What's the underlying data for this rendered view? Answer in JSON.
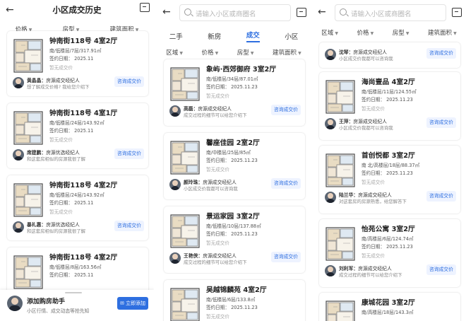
{
  "colors": {
    "accent": "#2e6fe0",
    "accent_bg": "#eef3ff",
    "muted": "#888888"
  },
  "icons": {
    "back": "back-arrow-icon",
    "message": "message-icon",
    "search": "search-icon",
    "chat": "chat-icon"
  },
  "panel1": {
    "title": "小区成交历史",
    "filters": [
      "价格",
      "房型",
      "建筑面积"
    ],
    "cards": [
      {
        "name": "钟南街118号 4室2厅",
        "meta": "南/低楼层/7层/317.91㎡",
        "date": "签约日期： 2025.11",
        "price": "暂无成交价",
        "agent": "黄晶晶：",
        "agent_role": "房源成交经纪人",
        "agent_msg": "想了解成交价格? 我给您介绍下",
        "button": "咨询成交价"
      },
      {
        "name": "钟南街118号 4室1厅",
        "meta": "南/低楼层/24层/143.92㎡",
        "date": "签约日期： 2025.11",
        "price": "暂无成交价",
        "agent": "席建鹏：",
        "agent_role": "房源优选经纪人",
        "agent_msg": "和这套房相似的房源我很了解",
        "button": "咨询成交价"
      },
      {
        "name": "钟南街118号 4室2厅",
        "meta": "南/低楼层/24层/143.92㎡",
        "date": "签约日期： 2025.11",
        "price": "暂无成交价",
        "agent": "暴礼惠：",
        "agent_role": "房源优选经纪人",
        "agent_msg": "和这套房相似的房源我很了解",
        "button": "咨询成交价"
      },
      {
        "name": "钟南街118号 4室2厅",
        "meta": "南/低楼层/8层/163.56㎡",
        "date": "签约日期： 2025.11",
        "price": "",
        "agent": "",
        "agent_role": "",
        "agent_msg": "",
        "button": ""
      }
    ],
    "bottom": {
      "title": "添加购房助手",
      "subtitle": "小区行情、成交动态等抢先知",
      "button": "立即添加"
    }
  },
  "panel2": {
    "search_placeholder": "请输入小区或商圈名",
    "tabs": [
      "二手",
      "新房",
      "成交",
      "小区"
    ],
    "filters": [
      "区域",
      "价格",
      "房型",
      "建筑面积"
    ],
    "cards": [
      {
        "name": "象屿·西郊御府 3室2厅",
        "meta": "南/低楼层/34层/87.01㎡",
        "date": "签约日期： 2025.11.23",
        "price": "暂无成交价",
        "agent": "高磊：",
        "agent_role": "房源成交经纪人",
        "agent_msg": "成交过程的细节可以给您介绍下",
        "button": "咨询成交价"
      },
      {
        "name": "馨座佳园 2室2厅",
        "meta": "南/中楼层/25层/85㎡",
        "date": "签约日期： 2025.11.23",
        "price": "暂无成交价",
        "agent": "颜玲珠：",
        "agent_role": "房源成交经纪人",
        "agent_msg": "小区成交价我都可以咨询我",
        "button": "咨询成交价"
      },
      {
        "name": "景运家园 3室2厅",
        "meta": "南/低楼层/10层/137.88㎡",
        "date": "签约日期： 2025.11.23",
        "price": "暂无成交价",
        "agent": "王艳侠：",
        "agent_role": "房源成交经纪人",
        "agent_msg": "成交过程的细节可以给您介绍下",
        "button": "咨询成交价"
      },
      {
        "name": "吴越锦麟苑 4室2厅",
        "meta": "南/低楼层/6层/133.8㎡",
        "date": "签约日期： 2025.11.23",
        "price": "暂无成交价",
        "agent": "",
        "agent_role": "",
        "agent_msg": "",
        "button": ""
      }
    ]
  },
  "panel3": {
    "search_placeholder": "请输入小区或商圈名",
    "filters": [
      "区域",
      "价格",
      "房型",
      "建筑面积"
    ],
    "first_agent": {
      "agent": "沈琴：",
      "agent_role": "房源成交经纪人",
      "agent_msg": "小区成交价我都可以咨询我",
      "button": "咨询成交价"
    },
    "cards": [
      {
        "name": "海尚壹品 4室2厅",
        "meta": "南/低楼层/11层/124.55㎡",
        "date": "签约日期： 2025.11.23",
        "price": "暂无成交价",
        "agent": "王萍：",
        "agent_role": "房源成交经纪人",
        "agent_msg": "小区成交价我都可以咨询我",
        "button": "咨询成交价"
      },
      {
        "name": "首创悦都 3室2厅",
        "meta": "南 北/高楼层/18层/88.37㎡",
        "date": "签约日期： 2025.11.23",
        "price": "暂无成交价",
        "agent": "陆兰华：",
        "agent_role": "房源成交经纪人",
        "agent_msg": "对这套房的房源熟悉，给您解答下",
        "button": "咨询成交价"
      },
      {
        "name": "怡苑公寓 3室2厅",
        "meta": "南/高楼层/6层/124.74㎡",
        "date": "签约日期： 2025.11.23",
        "price": "暂无成交价",
        "agent": "刘利军：",
        "agent_role": "房源成交经纪人",
        "agent_msg": "成交过程的细节可以给您介绍下",
        "button": "咨询成交价"
      },
      {
        "name": "康城花园 3室2厅",
        "meta": "南/高楼层/18层/143.3㎡",
        "date": "签约日期： 2025.11.23",
        "price": "",
        "agent": "",
        "agent_role": "",
        "agent_msg": "",
        "button": ""
      }
    ]
  }
}
